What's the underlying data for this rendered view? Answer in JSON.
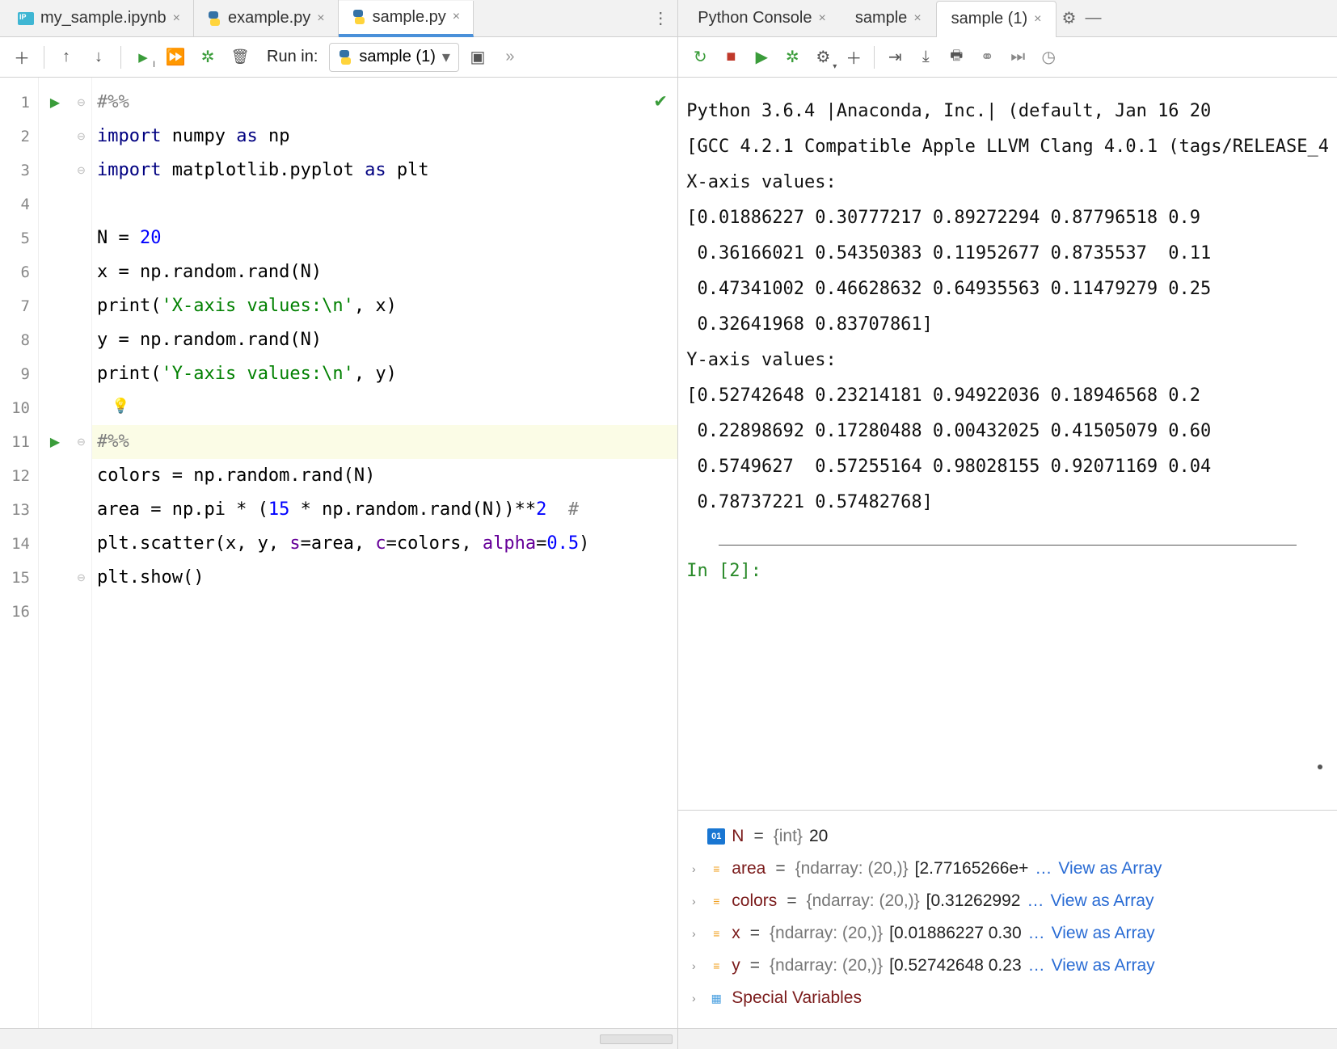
{
  "left": {
    "tabs": [
      {
        "label": "my_sample.ipynb",
        "icon": "nb"
      },
      {
        "label": "example.py",
        "icon": "py"
      },
      {
        "label": "sample.py",
        "icon": "py",
        "active": true
      }
    ],
    "toolbar": {
      "run_in_label": "Run in:",
      "run_combo": "sample (1)"
    },
    "code": {
      "lines": [
        {
          "n": 1,
          "run": true,
          "html": "<span class='cm'>#%%</span>"
        },
        {
          "n": 2,
          "html": "<span class='kw'>import</span> numpy <span class='kw'>as</span> np"
        },
        {
          "n": 3,
          "html": "<span class='kw'>import</span> matplotlib.pyplot <span class='kw'>as</span> plt"
        },
        {
          "n": 4,
          "html": ""
        },
        {
          "n": 5,
          "html": "N = <span class='num'>20</span>"
        },
        {
          "n": 6,
          "html": "x = np.random.rand(N)"
        },
        {
          "n": 7,
          "html": "print(<span class='str'>'X-axis values:\\n'</span>, x)"
        },
        {
          "n": 8,
          "html": "y = np.random.rand(N)"
        },
        {
          "n": 9,
          "html": "print(<span class='str'>'Y-axis values:\\n'</span>, y)"
        },
        {
          "n": 10,
          "html": ""
        },
        {
          "n": 11,
          "run": true,
          "cell": true,
          "html": "<span class='cm'>#%%</span>"
        },
        {
          "n": 12,
          "html": "colors = np.random.rand(N)"
        },
        {
          "n": 13,
          "html": "area = np.pi * (<span class='num'>15</span> * np.random.rand(N))**<span class='num'>2</span>  <span class='cm'>#</span>"
        },
        {
          "n": 14,
          "html": "plt.scatter(x, y, <span class='arg'>s</span>=area, <span class='arg'>c</span>=colors, <span class='arg'>alpha</span>=<span class='num'>0.5</span>)"
        },
        {
          "n": 15,
          "html": "plt.show()"
        },
        {
          "n": 16,
          "html": ""
        }
      ]
    }
  },
  "right": {
    "tabs": [
      {
        "label": "Python Console"
      },
      {
        "label": "sample"
      },
      {
        "label": "sample (1)",
        "active": true
      }
    ],
    "console_lines": [
      "Python 3.6.4 |Anaconda, Inc.| (default, Jan 16 20",
      "[GCC 4.2.1 Compatible Apple LLVM Clang 4.0.1 (tags/RELEASE_4",
      "X-axis values:",
      "[0.01886227 0.30777217 0.89272294 0.87796518 0.9",
      " 0.36166021 0.54350383 0.11952677 0.8735537  0.11",
      " 0.47341002 0.46628632 0.64935563 0.11479279 0.25",
      " 0.32641968 0.83707861]",
      "Y-axis values:",
      "[0.52742648 0.23214181 0.94922036 0.18946568 0.2",
      " 0.22898692 0.17280488 0.00432025 0.41505079 0.60",
      " 0.5749627  0.57255164 0.98028155 0.92071169 0.04",
      " 0.78737221 0.57482768]"
    ],
    "prompt": "In [2]:",
    "variables": [
      {
        "icon": "int01",
        "name": "N",
        "eq": "=",
        "type": "{int}",
        "val": "20",
        "expand": false
      },
      {
        "icon": "arr",
        "name": "area",
        "eq": "=",
        "type": "{ndarray: (20,)}",
        "val": "[2.77165266e+",
        "link": "View as Array",
        "expand": true
      },
      {
        "icon": "arr",
        "name": "colors",
        "eq": "=",
        "type": "{ndarray: (20,)}",
        "val": "[0.31262992 ",
        "link": "View as Array",
        "expand": true
      },
      {
        "icon": "arr",
        "name": "x",
        "eq": "=",
        "type": "{ndarray: (20,)}",
        "val": "[0.01886227 0.30",
        "link": "View as Array",
        "expand": true
      },
      {
        "icon": "arr",
        "name": "y",
        "eq": "=",
        "type": "{ndarray: (20,)}",
        "val": "[0.52742648 0.23",
        "link": "View as Array",
        "expand": true
      },
      {
        "icon": "special",
        "name": "Special Variables",
        "expand": true
      }
    ]
  }
}
